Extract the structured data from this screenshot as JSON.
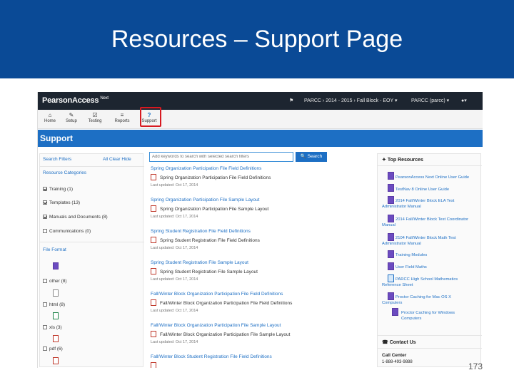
{
  "slide": {
    "title": "Resources – Support Page",
    "page_number": "173"
  },
  "topbar": {
    "brand": "PearsonAccess",
    "brand_suffix": "Next",
    "flag_icon": "flag-icon",
    "admin": "PARCC › 2014 - 2015 › Fall Block - EOY ▾",
    "org": "PARCC (parcc) ▾",
    "user_icon": "user-icon"
  },
  "nav": {
    "items": [
      {
        "label": "Home",
        "icon": "home-icon",
        "glyph": "⌂"
      },
      {
        "label": "Setup",
        "icon": "wrench-icon",
        "glyph": "✎"
      },
      {
        "label": "Testing",
        "icon": "checkbox-icon",
        "glyph": "☑"
      },
      {
        "label": "Reports",
        "icon": "list-icon",
        "glyph": "≡"
      },
      {
        "label": "Support",
        "icon": "help-icon",
        "glyph": "?"
      }
    ]
  },
  "page": {
    "title": "Support"
  },
  "filters": {
    "title": "Search Filters",
    "all_clear": "All  Clear  Hide",
    "categories_title": "Resource Categories",
    "categories": [
      {
        "label": "Training (1)",
        "checked": true
      },
      {
        "label": "Templates (13)",
        "checked": true
      },
      {
        "label": "Manuals and Documents (8)",
        "checked": true
      },
      {
        "label": "Communications (0)",
        "checked": false
      }
    ],
    "format_title": "File Format",
    "formats": [
      {
        "label": "other (8)",
        "icon": "doc"
      },
      {
        "label": "html (8)",
        "icon": "txt"
      },
      {
        "label": "xls (3)",
        "icon": "xls"
      },
      {
        "label": "pdf (6)",
        "icon": "pdf"
      }
    ]
  },
  "search": {
    "placeholder": "Add keywords to search with selected search filters",
    "button": "Search"
  },
  "results": [
    {
      "title": "Spring Organization Participation File Field Definitions",
      "file": "Spring Organization Participation File Field Definitions",
      "date": "Last updated: Oct 17, 2014"
    },
    {
      "title": "Spring Organization Participation File Sample Layout",
      "file": "Spring Organization Participation File Sample Layout",
      "date": "Last updated: Oct 17, 2014"
    },
    {
      "title": "Spring Student Registration File Field Definitions",
      "file": "Spring Student Registration File Field Definitions",
      "date": "Last updated: Oct 17, 2014"
    },
    {
      "title": "Spring Student Registration File Sample Layout",
      "file": "Spring Student Registration File Sample Layout",
      "date": "Last updated: Oct 17, 2014"
    },
    {
      "title": "Fall/Winter Block Organization Participation File Field Definitions",
      "file": "Fall/Winter Block Organization Participation File Field Definitions",
      "date": "Last updated: Oct 17, 2014"
    },
    {
      "title": "Fall/Winter Block Organization Participation File Sample Layout",
      "file": "Fall/Winter Block Organization Participation File Sample Layout",
      "date": "Last updated: Oct 17, 2014"
    },
    {
      "title": "Fall/Winter Block Student Registration File Field Definitions",
      "file": "",
      "date": ""
    }
  ],
  "top_resources": {
    "title": "Top Resources",
    "items": [
      "PearsonAccess Next Online User Guide",
      "TestNav 8 Online User Guide",
      "2014 Fall/Winter Block ELA Test Administrator Manual",
      "2014 Fall/Winter Block Test Coordinator Manual",
      "2104 Fall/Winter Block Math Test Administrator Manual",
      "Training Modules",
      "User Field Maths",
      "PARCC High School Mathematics Reference Sheet",
      "Proctor Caching for Mac OS X Computers",
      "Proctor Caching for Windows Computers"
    ]
  },
  "contact": {
    "title": "Contact Us",
    "call_center": "Call Center",
    "phone": "1-888-493-9888"
  }
}
